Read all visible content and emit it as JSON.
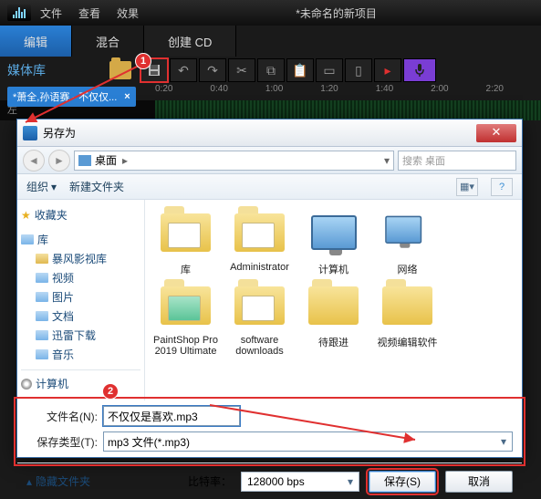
{
  "app": {
    "title": "*未命名的新项目",
    "menu": [
      "文件",
      "查看",
      "效果"
    ]
  },
  "tabs": {
    "edit": "编辑",
    "mix": "混合",
    "cd": "创建 CD"
  },
  "library": {
    "label": "媒体库",
    "clip": "*萧全,孙语赛 - 不仅仅..."
  },
  "ruler": [
    "0:20",
    "0:40",
    "1:00",
    "1:20",
    "1:40",
    "2:00",
    "2:20"
  ],
  "track": {
    "channel": "左"
  },
  "dialog": {
    "title": "另存为",
    "breadcrumb": "桌面",
    "search_placeholder": "搜索 桌面",
    "toolbar": {
      "organize": "组织",
      "newfolder": "新建文件夹"
    },
    "sidebar": {
      "favorites": "收藏夹",
      "libraries": "库",
      "items": [
        "暴风影视库",
        "视频",
        "图片",
        "文档",
        "迅雷下载",
        "音乐"
      ],
      "computer": "计算机"
    },
    "files": [
      "库",
      "Administrator",
      "计算机",
      "网络",
      "PaintShop Pro 2019 Ultimate",
      "software downloads",
      "待跟进",
      "视频编辑软件"
    ],
    "filename_label": "文件名(N):",
    "filename_value": "不仅仅是喜欢.mp3",
    "filetype_label": "保存类型(T):",
    "filetype_value": "mp3 文件(*.mp3)",
    "hide": "隐藏文件夹",
    "bitrate_label": "比特率：",
    "bitrate_value": "128000 bps",
    "save": "保存(S)",
    "cancel": "取消"
  },
  "annotations": {
    "a1": "1",
    "a2": "2"
  }
}
